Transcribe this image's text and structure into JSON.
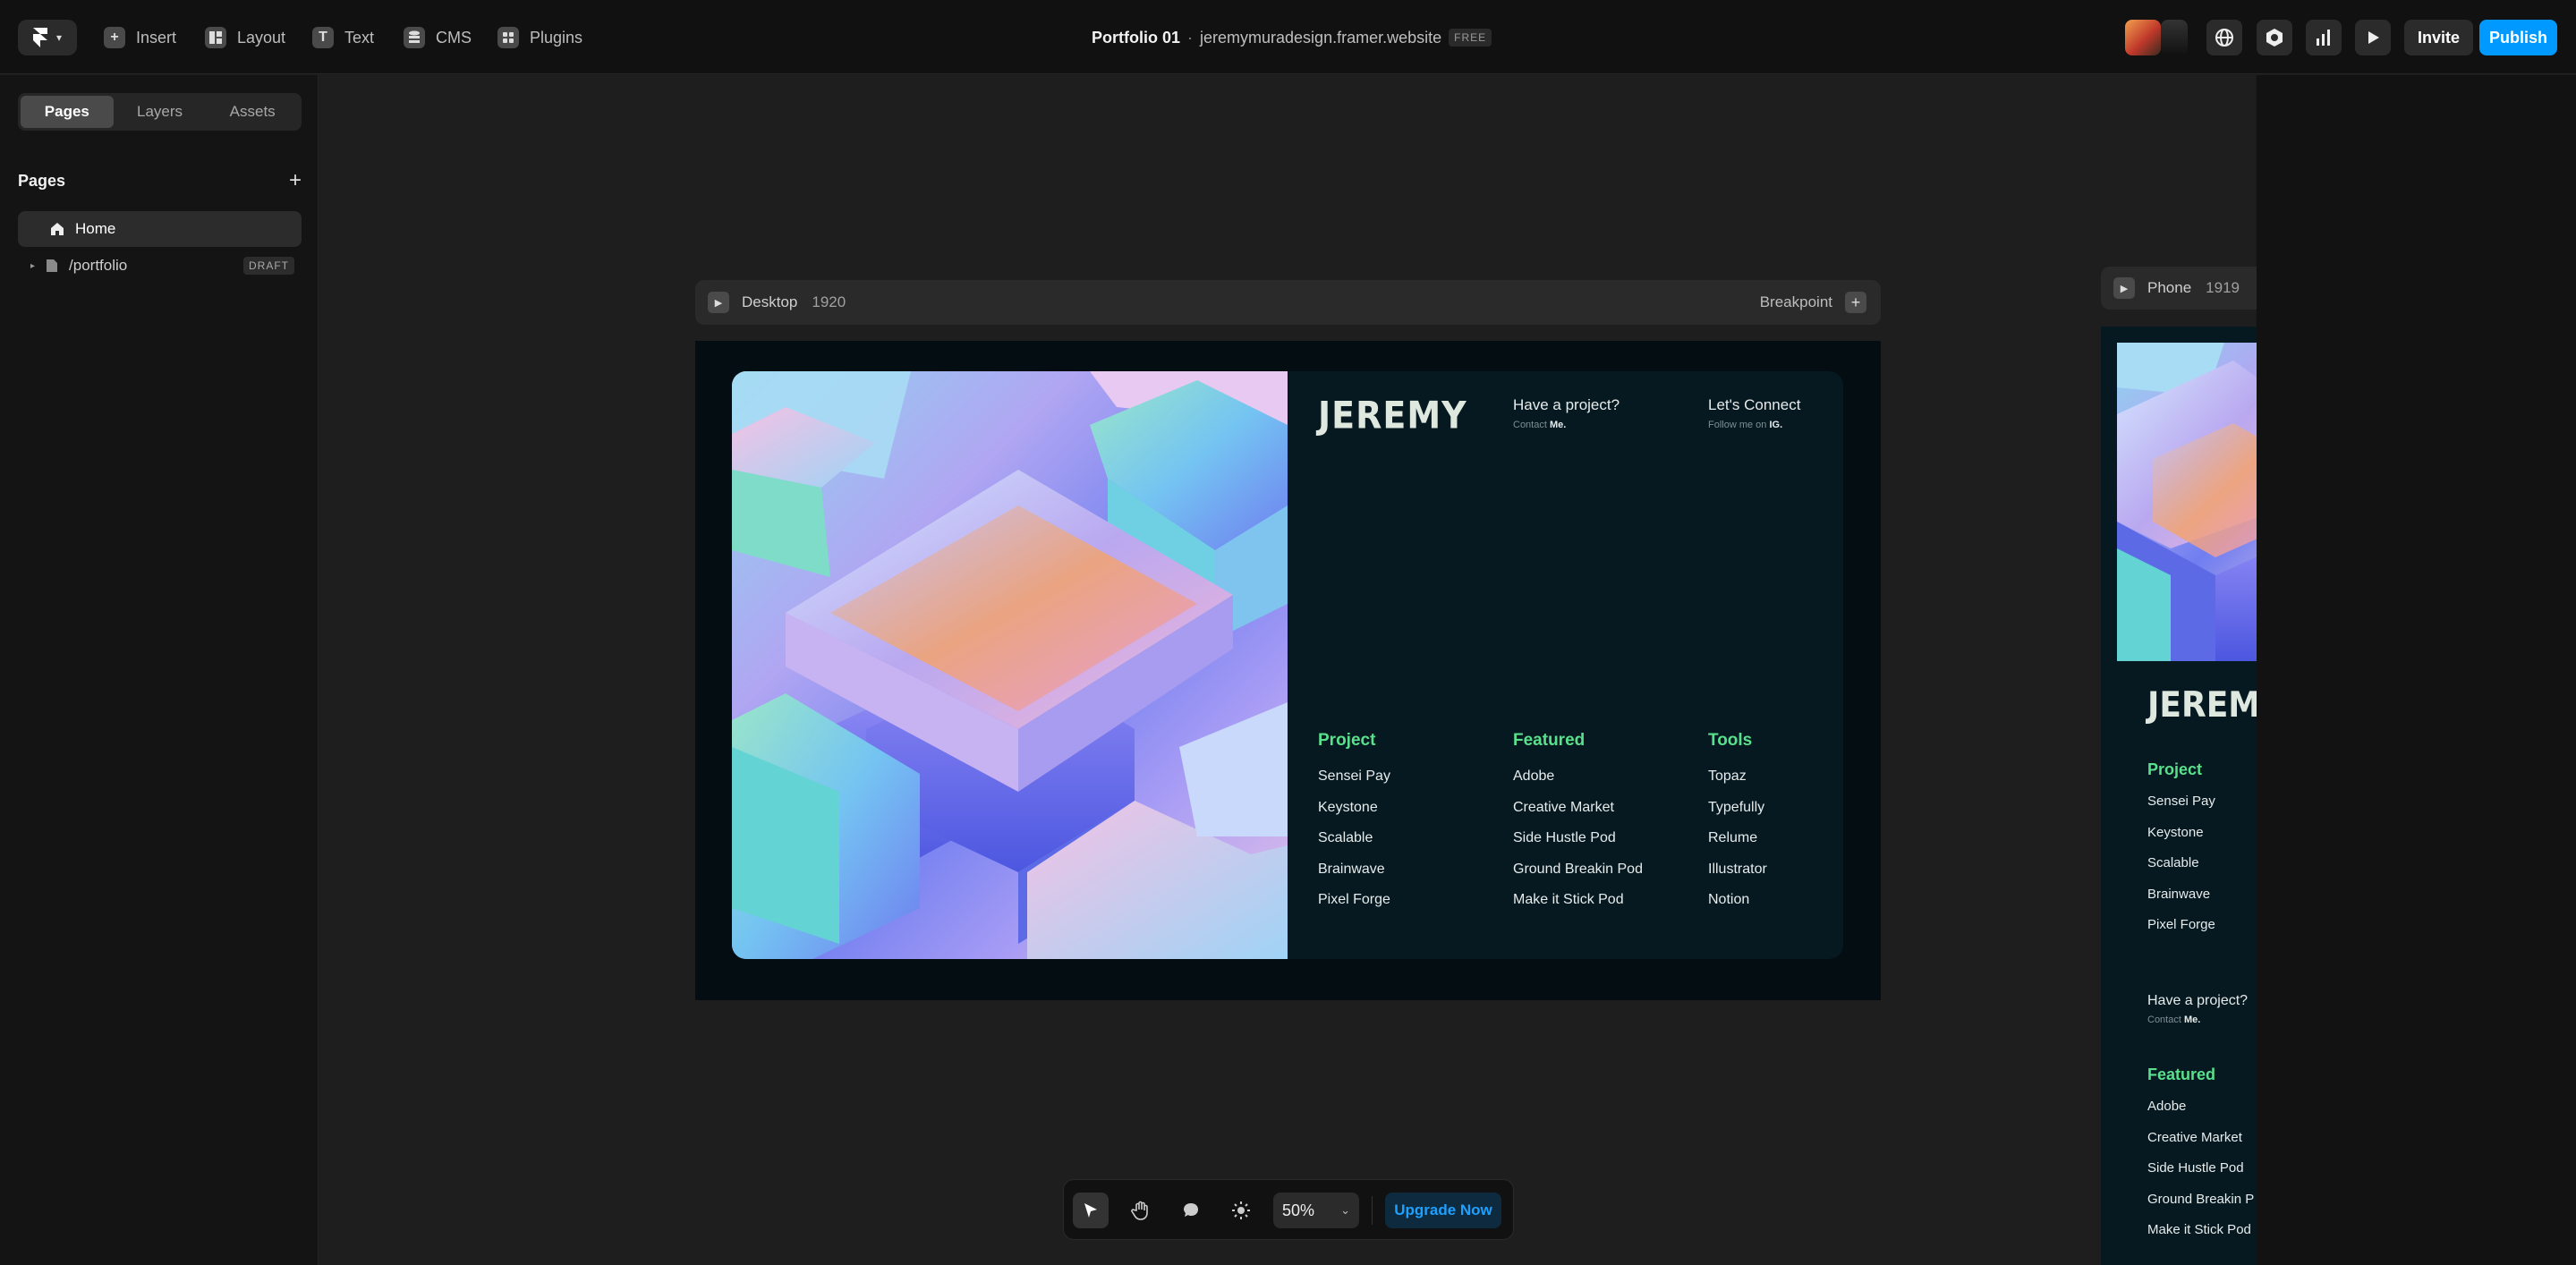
{
  "app": {
    "menu": [
      "Insert",
      "Layout",
      "Text",
      "CMS",
      "Plugins"
    ],
    "menu_icons": [
      "insert-icon",
      "layout-icon",
      "text-icon",
      "cms-icon",
      "plugins-icon"
    ],
    "title": "Portfolio 01",
    "separator": "·",
    "url": "jeremymuradesign.framer.website",
    "plan_badge": "FREE",
    "invite_label": "Invite",
    "publish_label": "Publish",
    "accent_color": "#0099ff"
  },
  "sidebar": {
    "tabs": [
      "Pages",
      "Layers",
      "Assets"
    ],
    "active_tab": "Pages",
    "section_title": "Pages",
    "add_symbol": "+",
    "pages": [
      {
        "label": "Home",
        "icon": "home-icon",
        "active": true
      },
      {
        "label": "/portfolio",
        "icon": "page-icon",
        "badge": "DRAFT"
      }
    ]
  },
  "canvas": {
    "desktop_frame": {
      "label": "Desktop",
      "width_label": "1920",
      "breakpoint_label": "Breakpoint"
    },
    "phone_frame": {
      "label": "Phone",
      "width_label": "1919"
    }
  },
  "site": {
    "brand": "JEREMY",
    "cta1": {
      "title": "Have a project?",
      "sub_prefix": "Contact",
      "sub_strong": "Me."
    },
    "cta2": {
      "title": "Let's Connect",
      "sub_prefix": "Follow me on",
      "sub_strong": "IG."
    },
    "columns": [
      {
        "heading": "Project",
        "items": [
          "Sensei Pay",
          "Keystone",
          "Scalable",
          "Brainwave",
          "Pixel Forge"
        ]
      },
      {
        "heading": "Featured",
        "items": [
          "Adobe",
          "Creative Market",
          "Side Hustle Pod",
          "Ground Breakin Pod",
          "Make it Stick Pod"
        ]
      },
      {
        "heading": "Tools",
        "items": [
          "Topaz",
          "Typefully",
          "Relume",
          "Illustrator",
          "Notion"
        ]
      }
    ],
    "phone_featured_items": [
      "Adobe",
      "Creative Market",
      "Side Hustle Pod",
      "Ground Breakin P",
      "Make it Stick Pod"
    ],
    "heading_color": "#59e08c"
  },
  "bottom_toolbar": {
    "tools": [
      "pointer-icon",
      "hand-icon",
      "comment-icon",
      "theme-icon"
    ],
    "zoom": "50%",
    "upgrade_label": "Upgrade Now"
  }
}
